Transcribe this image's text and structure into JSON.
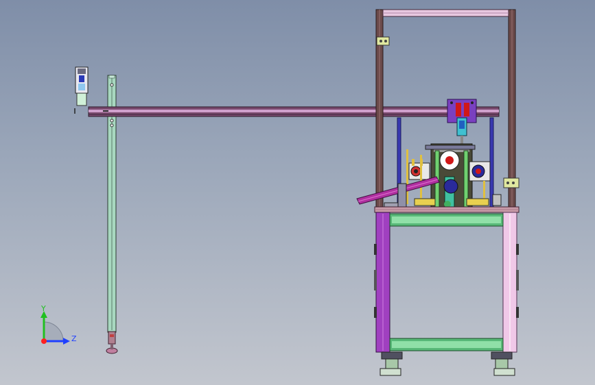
{
  "viewport": {
    "background_top": "#7f8ea8",
    "background_bottom": "#c2c6ce"
  },
  "model": {
    "colors": {
      "frame": "#ffffff",
      "post": "#6b4a4a",
      "beam": "#7a4a6e",
      "beam_highlight": "#d0a0cc",
      "rail": "#a8d8c0",
      "cabinet_side": "#a040c0",
      "cabinet_panel": "#f0c8e8",
      "table_top": "#c89aa8",
      "cross_bar": "#58b878",
      "base_plate": "#d8d8d8",
      "cylinder_blue": "#2a2a9a",
      "ramp": "#b030a0",
      "bracket_purple": "#7a40c0",
      "yellow_part": "#e0c040",
      "red_part": "#d01818",
      "teal_part": "#40b0a0"
    }
  },
  "triad": {
    "labels": {
      "y": "Y",
      "z": "Z"
    },
    "colors": {
      "y": "#20c020",
      "z": "#2040ff",
      "x": "#ff2020"
    }
  }
}
